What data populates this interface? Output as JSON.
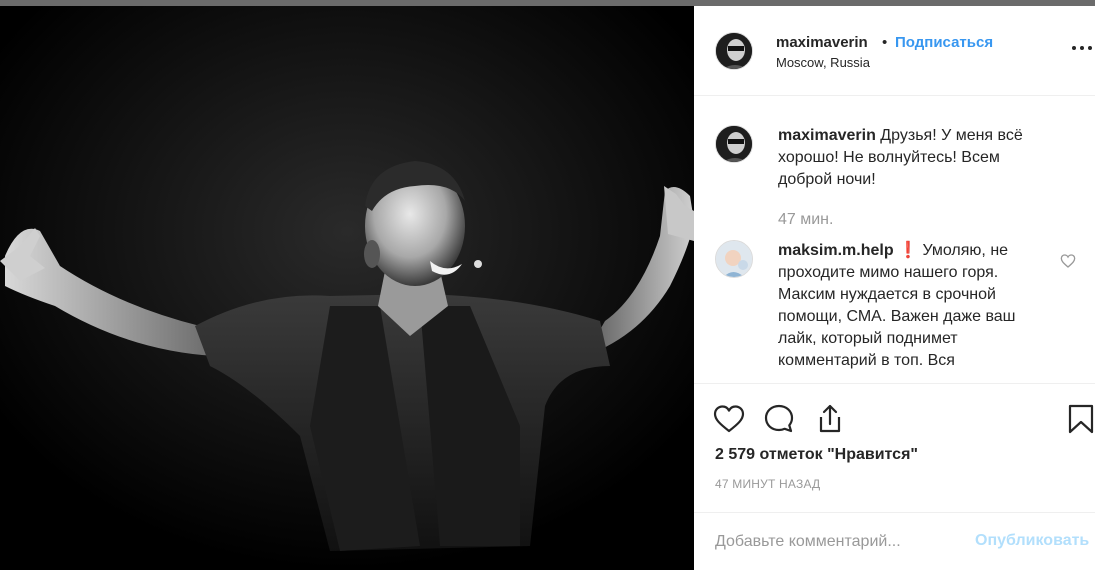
{
  "post": {
    "author": "maximaverin",
    "separator": "•",
    "follow_label": "Подписаться",
    "location": "Moscow, Russia",
    "icons": {
      "more": "more-icon",
      "like": "heart-icon",
      "comment": "comment-icon",
      "share": "share-icon",
      "save": "bookmark-icon"
    }
  },
  "comments": [
    {
      "username": "maximaverin",
      "text": "Друзья! У меня всё хорошо! Не волнуйтесь! Всем доброй ночи!",
      "time": "47 мин."
    },
    {
      "username": "maksim.m.help",
      "emoji": "❗",
      "text": "Умоляю, не проходите мимо нашего горя. Максим нуждается в срочной помощи, СМА. Важен даже ваш лайк, который поднимет комментарий в топ. Вся"
    }
  ],
  "likes": "2 579 отметок \"Нравится\"",
  "posted_ago": "47 МИНУТ НАЗАД",
  "add_comment": {
    "placeholder": "Добавьте комментарий...",
    "publish_label": "Опубликовать"
  },
  "colors": {
    "accent": "#3897f0",
    "publish_disabled": "#b2dffc",
    "muted": "#999999",
    "text": "#262626"
  }
}
